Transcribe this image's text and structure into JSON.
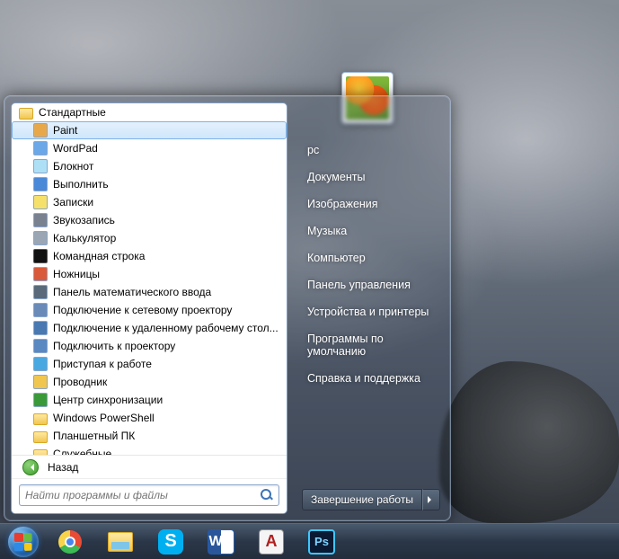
{
  "start_menu": {
    "folder_label": "Стандартные",
    "programs": [
      {
        "label": "Paint",
        "icon": "paint-icon",
        "selected": true
      },
      {
        "label": "WordPad",
        "icon": "wordpad-icon"
      },
      {
        "label": "Блокнот",
        "icon": "notepad-icon"
      },
      {
        "label": "Выполнить",
        "icon": "run-icon"
      },
      {
        "label": "Записки",
        "icon": "stickynotes-icon"
      },
      {
        "label": "Звукозапись",
        "icon": "soundrecorder-icon"
      },
      {
        "label": "Калькулятор",
        "icon": "calculator-icon"
      },
      {
        "label": "Командная строка",
        "icon": "cmd-icon"
      },
      {
        "label": "Ножницы",
        "icon": "snipping-icon"
      },
      {
        "label": "Панель математического ввода",
        "icon": "mathinput-icon"
      },
      {
        "label": "Подключение к сетевому проектору",
        "icon": "netprojector-icon"
      },
      {
        "label": "Подключение к удаленному рабочему стол...",
        "icon": "rdp-icon"
      },
      {
        "label": "Подключить к проектору",
        "icon": "projector-icon"
      },
      {
        "label": "Приступая к работе",
        "icon": "gettingstarted-icon"
      },
      {
        "label": "Проводник",
        "icon": "explorer-icon"
      },
      {
        "label": "Центр синхронизации",
        "icon": "synccenter-icon"
      },
      {
        "label": "Windows PowerShell",
        "icon": "folder-icon",
        "folder": true
      },
      {
        "label": "Планшетный ПК",
        "icon": "folder-icon",
        "folder": true
      },
      {
        "label": "Служебные",
        "icon": "folder-icon",
        "folder": true
      }
    ],
    "back_label": "Назад",
    "search_placeholder": "Найти программы и файлы"
  },
  "right_pane": {
    "items": [
      "pc",
      "Документы",
      "Изображения",
      "Музыка",
      "Компьютер",
      "Панель управления",
      "Устройства и принтеры",
      "Программы по умолчанию",
      "Справка и поддержка"
    ],
    "shutdown_label": "Завершение работы"
  },
  "taskbar": {
    "items": [
      {
        "name": "start",
        "icon": "start-orb"
      },
      {
        "name": "chrome",
        "icon": "chrome-icon"
      },
      {
        "name": "explorer",
        "icon": "explorer-icon"
      },
      {
        "name": "skype",
        "icon": "skype-icon",
        "glyph": "S"
      },
      {
        "name": "word",
        "icon": "word-icon",
        "glyph": "W"
      },
      {
        "name": "autocad",
        "icon": "autocad-icon",
        "glyph": "A"
      },
      {
        "name": "photoshop",
        "icon": "photoshop-icon",
        "glyph": "Ps"
      }
    ]
  }
}
